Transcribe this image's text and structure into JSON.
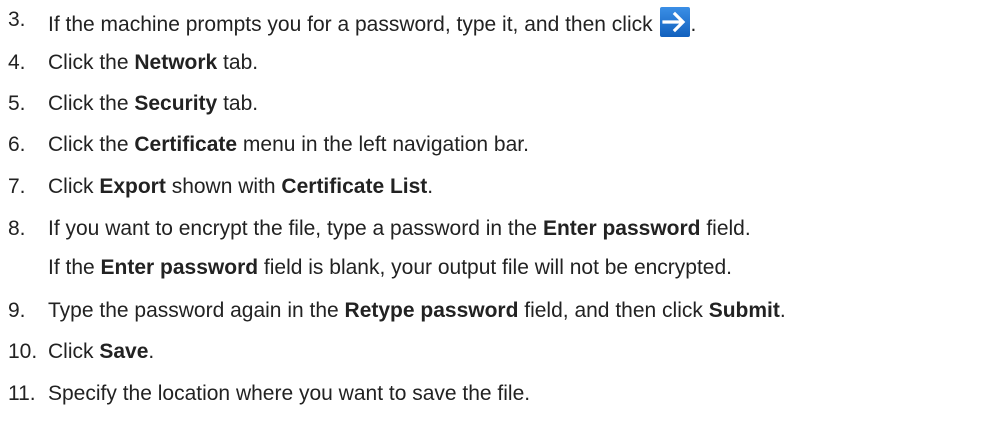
{
  "steps": [
    {
      "number": "3.",
      "parts": [
        "If the machine prompts you for a password, type it, and then click ",
        "."
      ],
      "icon": "arrow-right-icon",
      "icon_colors": {
        "background": "#1a73d1",
        "arrow": "#ffffff"
      }
    },
    {
      "number": "4.",
      "parts": [
        "Click the ",
        "Network",
        " tab."
      ]
    },
    {
      "number": "5.",
      "parts": [
        "Click the ",
        "Security",
        " tab."
      ]
    },
    {
      "number": "6.",
      "parts": [
        "Click the ",
        "Certificate",
        " menu in the left navigation bar."
      ]
    },
    {
      "number": "7.",
      "parts": [
        "Click ",
        "Export",
        " shown with ",
        "Certificate List",
        "."
      ]
    },
    {
      "number": "8.",
      "parts": [
        "If you want to encrypt the file, type a password in the ",
        "Enter password",
        " field."
      ],
      "note": [
        "If the ",
        "Enter password",
        " field is blank, your output file will not be encrypted."
      ]
    },
    {
      "number": "9.",
      "parts": [
        "Type the password again in the ",
        "Retype password",
        " field, and then click ",
        "Submit",
        "."
      ]
    },
    {
      "number": "10.",
      "parts": [
        "Click ",
        "Save",
        "."
      ]
    },
    {
      "number": "11.",
      "parts": [
        "Specify the location where you want to save the file."
      ]
    }
  ]
}
